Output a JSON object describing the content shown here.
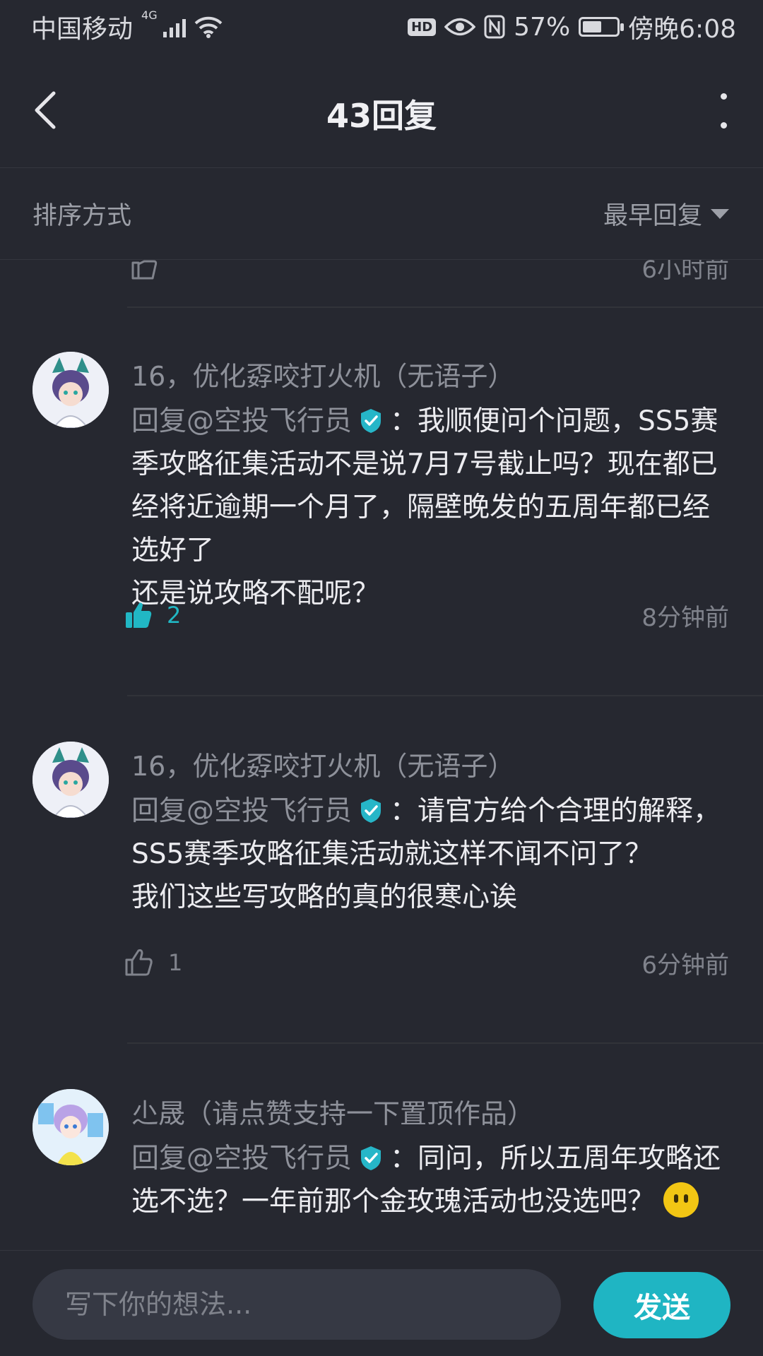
{
  "status_bar": {
    "carrier": "中国移动",
    "network": "4G",
    "hd_label": "HD",
    "battery": "57%",
    "battery_level": 0.57,
    "time": "傍晚6:08"
  },
  "header": {
    "title": "43回复"
  },
  "sort": {
    "label": "排序方式",
    "selected": "最早回复"
  },
  "previous_comment": {
    "time": "6小时前"
  },
  "comments": [
    {
      "author": "16，优化孬咬打火机（无语子）",
      "mention": "回复@空投飞行员",
      "body_line1": "：我顺便问个问题，SS5",
      "body_rest": "赛季攻略征集活动不是说7月7号截止吗？现在都已经将近逾期一个月了，隔壁晚发的五周年都已经选好了",
      "body_line_last": "还是说攻略不配呢？",
      "likes": "2",
      "liked": true,
      "time": "8分钟前"
    },
    {
      "author": "16，优化孬咬打火机（无语子）",
      "mention": "回复@空投飞行员",
      "body_line1": "：请官方给个合理的解",
      "body_rest": "释，SS5赛季攻略征集活动就这样不闻不问了？",
      "body_line_last": "我们这些写攻略的真的很寒心诶",
      "likes": "1",
      "liked": false,
      "time": "6分钟前"
    },
    {
      "author": "尐晟（请点赞支持一下置顶作品）",
      "mention": "回复@空投飞行员",
      "body_line1": "：同问，所以五周年攻",
      "body_rest": "略还选不选？一年前那个金玫瑰活动也没选吧？"
    }
  ],
  "composer": {
    "placeholder": "写下你的想法...",
    "send_label": "发送"
  },
  "colors": {
    "background": "#262830",
    "accent": "#1fb5c3",
    "muted_text": "#8e919a"
  }
}
